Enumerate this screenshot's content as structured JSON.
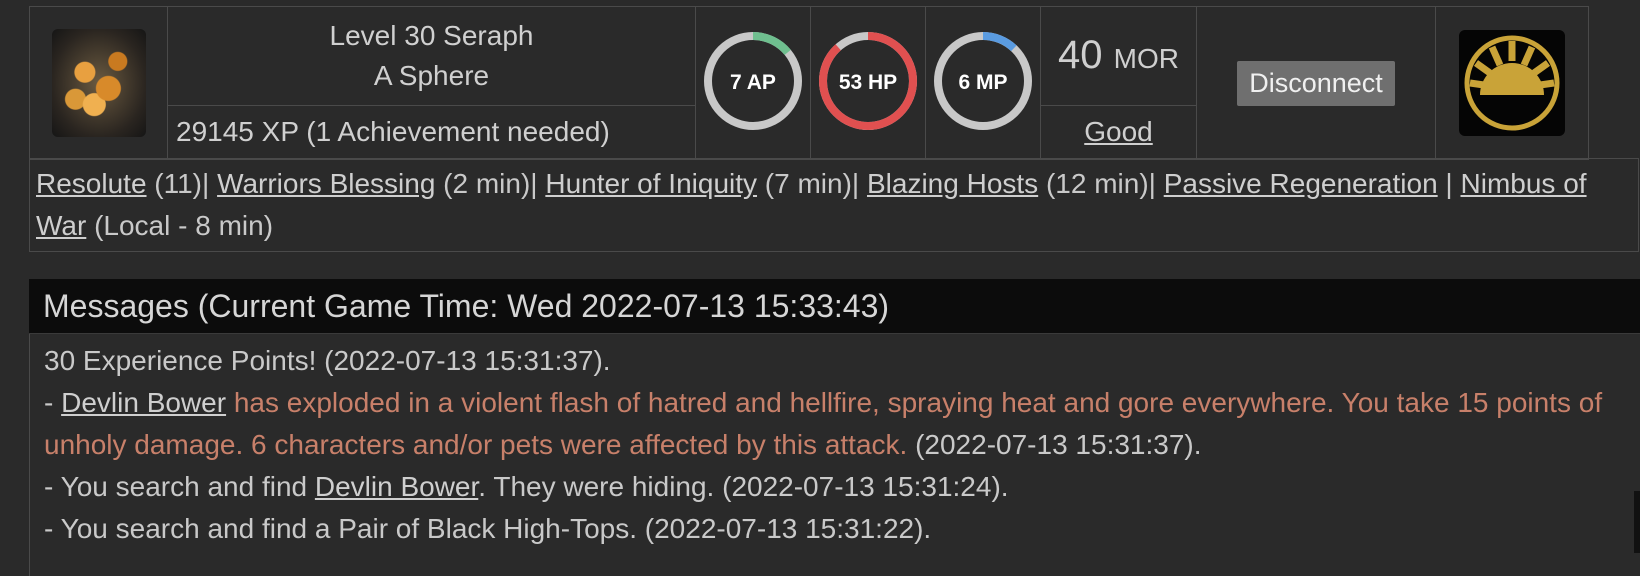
{
  "character": {
    "level_line": "Level 30 Seraph",
    "location": "A Sphere",
    "xp_text": "29145 XP (1 Achievement needed)",
    "avatar_icon": "character-portrait"
  },
  "stats": {
    "ap": {
      "label": "7 AP",
      "value": 7,
      "max": 50,
      "color": "#6fbf8f"
    },
    "hp": {
      "label": "53 HP",
      "value": 53,
      "max": 60,
      "color": "#e05050"
    },
    "mp": {
      "label": "6 MP",
      "value": 6,
      "max": 50,
      "color": "#5a9be0"
    }
  },
  "morality": {
    "value": "40",
    "unit": "MOR",
    "alignment": "Good"
  },
  "disconnect_label": "Disconnect",
  "logo_icon": "sunburst-faction-icon",
  "effects": [
    {
      "name": "Resolute",
      "detail": " (11)| "
    },
    {
      "name": "Warriors Blessing",
      "detail": " (2 min)| "
    },
    {
      "name": "Hunter of Iniquity",
      "detail": " (7 min)| "
    },
    {
      "name": "Blazing Hosts",
      "detail": " (12 min)| "
    },
    {
      "name": "Passive Regeneration",
      "detail": " | "
    },
    {
      "name": "Nimbus of War",
      "detail": " (Local - 8 min)"
    }
  ],
  "messages": {
    "header": "Messages (Current Game Time: Wed 2022-07-13 15:33:43)",
    "line1": "30 Experience Points! (2022-07-13 15:31:37).",
    "line2_prefix": "- ",
    "line2_link": "Devlin Bower",
    "line2_red": " has exploded in a violent flash of hatred and hellfire, spraying heat and gore everywhere. You take 15 points of unholy damage. 6 characters and/or pets were affected by this attack.",
    "line2_suffix": " (2022-07-13 15:31:37).",
    "line3_prefix": "- You search and find ",
    "line3_link": "Devlin Bower",
    "line3_suffix": ". They were hiding. (2022-07-13 15:31:24).",
    "line4": "- You search and find a Pair of Black High-Tops. (2022-07-13 15:31:22)."
  }
}
